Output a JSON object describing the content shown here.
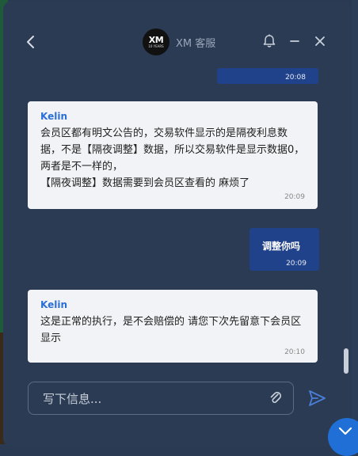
{
  "header": {
    "logo_text": "XM",
    "logo_subtext": "10 YEARS",
    "title": "XM 客服"
  },
  "messages": [
    {
      "direction": "out",
      "text": "",
      "time": "20:08"
    },
    {
      "direction": "in",
      "sender": "Kelin",
      "text": "会员区都有明文公告的，交易软件显示的是隔夜利息数据，不是【隔夜调整】数据，所以交易软件是显示数据0，  两者是不一样的，\n【隔夜调整】数据需要到会员区查看的 麻烦了",
      "time": "20:09"
    },
    {
      "direction": "out",
      "text": "调整你吗",
      "time": "20:09"
    },
    {
      "direction": "in",
      "sender": "Kelin",
      "text": "这是正常的执行，是不会赔偿的 请您下次先留意下会员区显示",
      "time": "20:10"
    }
  ],
  "composer": {
    "placeholder": "写下信息..."
  },
  "colors": {
    "window_bg": "#2b3b54",
    "outgoing_bubble": "#20428a",
    "incoming_bubble": "#f2f3f6",
    "sender_name": "#2a6fd6",
    "accent": "#1f6fd6"
  },
  "icons": [
    "back-arrow-icon",
    "bell-icon",
    "minimize-icon",
    "close-icon",
    "paperclip-icon",
    "send-icon",
    "chevron-down-icon"
  ]
}
